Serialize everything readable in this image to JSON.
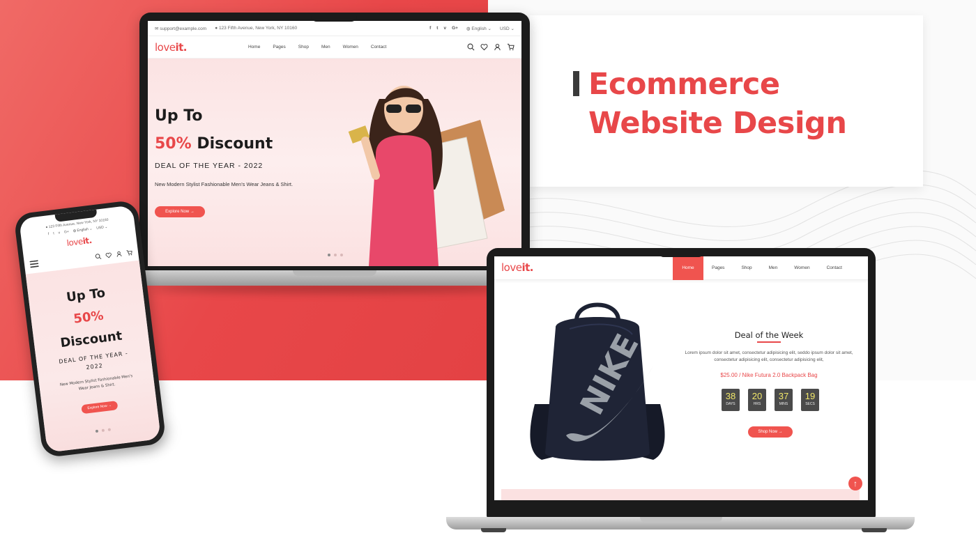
{
  "title": {
    "line1": "Ecommerce",
    "line2": "Website Design"
  },
  "brand": {
    "name_light": "love",
    "name_bold": "it",
    "name_dot": ".",
    "accent": "#e84749"
  },
  "laptop1": {
    "topbar": {
      "email": "support@example.com",
      "address": "123 Fifth Avenue, New York, NY 10160",
      "social": [
        "f",
        "t",
        "v",
        "G+"
      ],
      "language": "English",
      "currency": "USD"
    },
    "nav": [
      "Home",
      "Pages",
      "Shop",
      "Men",
      "Women",
      "Contact"
    ],
    "hero": {
      "line1": "Up To",
      "pct": "50%",
      "line2_rest": " Discount",
      "deal": "DEAL OF THE YEAR - 2022",
      "desc": "New Modern Stylist Fashionable Men's Wear Jeans & Shirt.",
      "button": "Explore Now →"
    }
  },
  "laptop2": {
    "nav": [
      "Home",
      "Pages",
      "Shop",
      "Men",
      "Women",
      "Contact"
    ],
    "deal": {
      "title": "Deal of the Week",
      "desc": "Lorem ipsum dolor sit amet, consectetur adipisicing elit, seddo ipsum dolor sit amet, consectetur adipisicing elit, consectetur adipisicing elit,",
      "price": "$25.00 / Nike Futura 2.0 Backpack Bag",
      "countdown": [
        {
          "value": "38",
          "label": "DAYS"
        },
        {
          "value": "20",
          "label": "HRS"
        },
        {
          "value": "37",
          "label": "MINS"
        },
        {
          "value": "19",
          "label": "SECS"
        }
      ],
      "button": "Shop Now →",
      "bag_logo": "NIKE"
    }
  },
  "phone": {
    "topbar": {
      "address": "123 Fifth Avenue, New York, NY 10160",
      "social": [
        "f",
        "t",
        "v",
        "G+"
      ],
      "language": "English",
      "currency": "USD"
    },
    "hero": {
      "line1": "Up To",
      "pct": "50%",
      "line3": "Discount",
      "deal": "DEAL OF THE YEAR - 2022",
      "desc": "New Modern Stylist Fashionable Men's Wear Jeans & Shirt.",
      "button": "Explore Now →"
    }
  }
}
